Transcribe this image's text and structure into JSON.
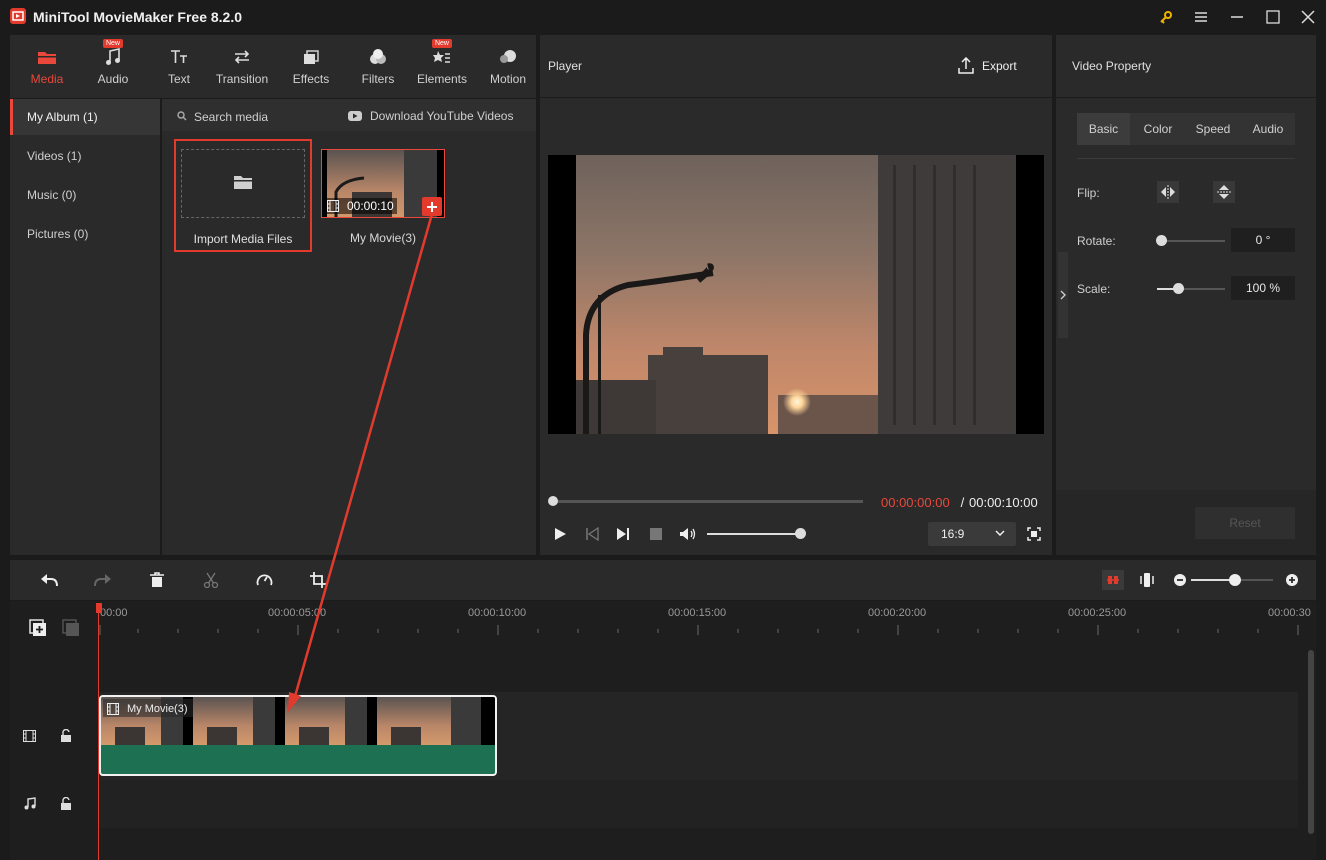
{
  "app": {
    "title": "MiniTool MovieMaker Free 8.2.0"
  },
  "toolbar": {
    "tabs": [
      {
        "label": "Media",
        "icon": "folder-icon",
        "active": true
      },
      {
        "label": "Audio",
        "icon": "music-note-icon",
        "badge": "New"
      },
      {
        "label": "Text",
        "icon": "text-icon"
      },
      {
        "label": "Transition",
        "icon": "transition-arrows-icon"
      },
      {
        "label": "Effects",
        "icon": "effects-icon"
      },
      {
        "label": "Filters",
        "icon": "filters-icon"
      },
      {
        "label": "Elements",
        "icon": "elements-icon",
        "badge": "New"
      },
      {
        "label": "Motion",
        "icon": "motion-icon"
      }
    ]
  },
  "album": {
    "items": [
      {
        "label": "My Album (1)",
        "active": true
      },
      {
        "label": "Videos (1)"
      },
      {
        "label": "Music (0)"
      },
      {
        "label": "Pictures (0)"
      }
    ]
  },
  "media": {
    "search_label": "Search media",
    "download_label": "Download YouTube Videos",
    "import_label": "Import Media Files",
    "clip_name": "My Movie(3)",
    "clip_duration": "00:00:10"
  },
  "player": {
    "title": "Player",
    "export_label": "Export",
    "current_time": "00:00:00:00",
    "separator": " / ",
    "total_time": "00:00:10:00",
    "aspect_ratio": "16:9",
    "progress": 0,
    "volume": 1.0
  },
  "property": {
    "title": "Video Property",
    "tabs": [
      "Basic",
      "Color",
      "Speed",
      "Audio"
    ],
    "flip_label": "Flip:",
    "rotate_label": "Rotate:",
    "rotate_value": "0 °",
    "scale_label": "Scale:",
    "scale_value": "100 %",
    "reset_label": "Reset"
  },
  "timeline": {
    "ticks": [
      "00:00",
      "00:00:05:00",
      "00:00:10:00",
      "00:00:15:00",
      "00:00:20:00",
      "00:00:25:00",
      "00:00:30"
    ],
    "clip_label": "My Movie(3)",
    "zoom_level": 0.6
  },
  "colors": {
    "accent": "#e9483a",
    "clip_green": "#1e7052",
    "panel": "#2a2a2a"
  }
}
